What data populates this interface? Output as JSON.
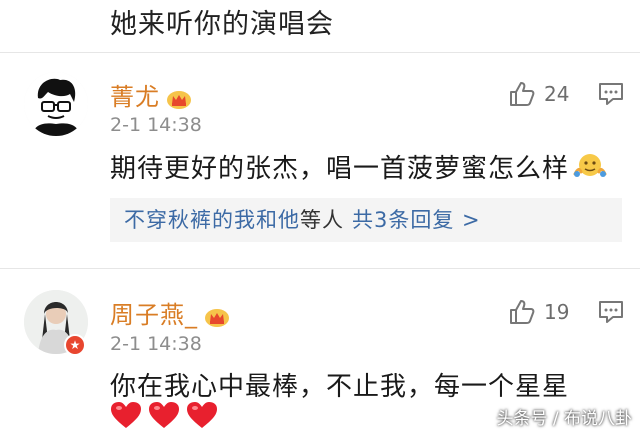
{
  "previous_comment_tail": "她来听你的演唱会",
  "comments": [
    {
      "username": "菁尤",
      "timestamp": "2-1 14:38",
      "likes": "24",
      "text": "期待更好的张杰，唱一首菠萝蜜怎么样",
      "emoji": "shrug-emoji",
      "replies": {
        "names": "不穿秋裤的我和他",
        "suffix": "等人",
        "more": "共3条回复 >"
      }
    },
    {
      "username": "周子燕_",
      "timestamp": "2-1 14:38",
      "likes": "19",
      "text": "你在我心中最棒，不止我，每一个星星",
      "emoji": "heart-emoji",
      "hearts": 3
    }
  ],
  "watermark": "头条号 / 布说八卦",
  "colors": {
    "username": "#d97d25",
    "link": "#3c6aa5",
    "timestamp": "#8d8d8d",
    "reply_bg": "#f4f4f4",
    "heart": "#e8202e"
  }
}
